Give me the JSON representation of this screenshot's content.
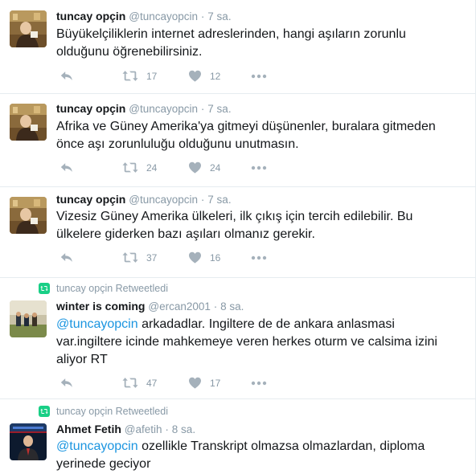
{
  "tweets": [
    {
      "name": "tuncay opçin",
      "handle": "@tuncayopcin",
      "separator": "·",
      "time": "7 sa.",
      "text": "Büyükelçiliklerin internet adreslerinden, hangi aşıların zorunlu olduğunu öğrenebilirsiniz.",
      "retweets": "17",
      "likes": "12"
    },
    {
      "name": "tuncay opçin",
      "handle": "@tuncayopcin",
      "separator": "·",
      "time": "7 sa.",
      "text": "Afrika ve Güney Amerika'ya gitmeyi düşünenler, buralara gitmeden önce aşı zorunluluğu olduğunu unutmasın.",
      "retweets": "24",
      "likes": "24"
    },
    {
      "name": "tuncay opçin",
      "handle": "@tuncayopcin",
      "separator": "·",
      "time": "7 sa.",
      "text": "Vizesiz Güney Amerika ülkeleri, ilk çıkış için tercih edilebilir. Bu ülkelere giderken bazı aşıları olmanız gerekir.",
      "retweets": "37",
      "likes": "16"
    },
    {
      "retweeted_by": "tuncay opçin Retweetledi",
      "name": "winter is coming",
      "handle": "@ercan2001",
      "separator": "·",
      "time": "8 sa.",
      "mention": "@tuncayopcin",
      "text": " arkadadlar. Ingiltere de de ankara anlasmasi var.ingiltere icinde mahkemeye veren herkes oturm ve calsima izini aliyor RT",
      "retweets": "47",
      "likes": "17"
    },
    {
      "retweeted_by": "tuncay opçin Retweetledi",
      "name": "Ahmet Fetih",
      "handle": "@afetih",
      "separator": "·",
      "time": "8 sa.",
      "mention": "@tuncayopcin",
      "text": " ozellikle Transkript olmazsa olmazlardan, diploma yerinede geciyor"
    }
  ],
  "icons": {
    "reply": "reply-icon",
    "retweet": "retweet-icon",
    "like": "heart-icon",
    "more": "more-icon"
  },
  "colors": {
    "link": "#1b95e0",
    "muted": "#8899a6",
    "icon": "#a5b1bb",
    "retweet_badge": "#19cf86",
    "divider": "#e6ecf0"
  }
}
